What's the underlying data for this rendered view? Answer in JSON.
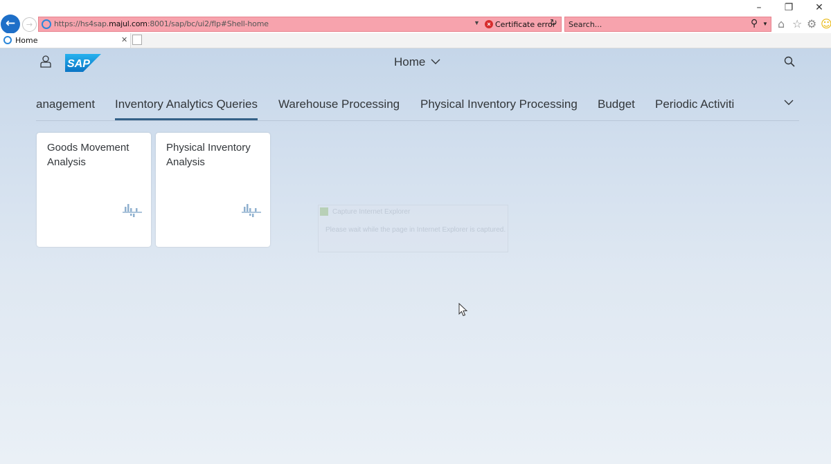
{
  "browser": {
    "address": {
      "url_prefix": "https://hs4sap.",
      "url_domain": "majul.com",
      "url_suffix": ":8001/sap/bc/ui2/flp#Shell-home",
      "certificate_status": "Certificate error"
    },
    "search": {
      "placeholder": "Search..."
    },
    "tab": {
      "title": "Home"
    },
    "window_buttons": {
      "minimize": "–",
      "restore": "❐",
      "close": "✕"
    }
  },
  "shell": {
    "title": "Home",
    "anchor_tabs": [
      {
        "label": "anagement"
      },
      {
        "label": "Inventory Analytics Queries",
        "selected": true
      },
      {
        "label": "Warehouse Processing"
      },
      {
        "label": "Physical Inventory Processing"
      },
      {
        "label": "Budget"
      },
      {
        "label": "Periodic Activiti"
      }
    ],
    "tiles": [
      {
        "title": "Goods Movement Analysis",
        "icon": "analysis-chart-icon"
      },
      {
        "title": "Physical Inventory Analysis",
        "icon": "analysis-chart-icon"
      }
    ]
  },
  "capture_dialog": {
    "title": "Capture Internet Explorer",
    "message": "Please wait while the page in Internet Explorer is captured."
  },
  "colors": {
    "accent": "#346187",
    "sap_blue": "#1a8ed8",
    "shell_bg_top": "#c5d6e9",
    "shell_bg_bottom": "#eaf0f6",
    "address_error_bg": "#f7a3ad",
    "text": "#32363a"
  }
}
